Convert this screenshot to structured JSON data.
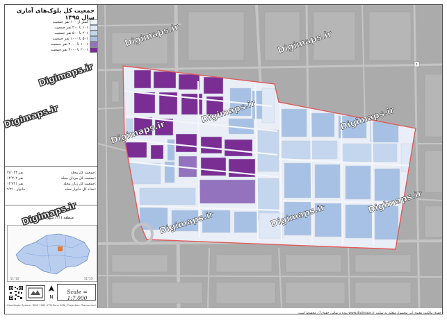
{
  "title": "جمعیت کل بلوک‌های آماری سال ۱۳۹۵",
  "legend": [
    {
      "label": "کمتر از ۱۰۰ نفر جمعیت",
      "color": "#edf2fa"
    },
    {
      "label": "۱۰۱ تا ۲۰۰ نفر جمعیت",
      "color": "#dfe8f6"
    },
    {
      "label": "۲۰۱ تا ۵۰۰ نفر جمعیت",
      "color": "#c4d6ee"
    },
    {
      "label": "۵۰۱ تا ۱۰۰۰ نفر جمعیت",
      "color": "#a7c1e4"
    },
    {
      "label": "۱۰۰۱ تا ۲۰۰۰ نفر جمعیت",
      "color": "#9373bd"
    },
    {
      "label": "۲۰۰۱ تا ۳۰۰۰ نفر جمعیت",
      "color": "#7a2e94"
    }
  ],
  "stats": [
    {
      "label": "جمعیت کل محله:",
      "value": "۲۸٬۰۲۳ نفر"
    },
    {
      "label": "جمعیت کل مردان محله:",
      "value": "۱۴٬۳۰۲ نفر"
    },
    {
      "label": "جمعیت کل زنان محله:",
      "value": "۱۳٬۷۲۱ نفر"
    },
    {
      "label": "تعداد کل خانوار محله:",
      "value": "۹٬۴۱۰ خانوار"
    }
  ],
  "location": {
    "line1": "محله امیریه",
    "line2": "منطقه (۱۱) شهرداری تهران"
  },
  "scale": "Scale = 1:7,000",
  "north": "N",
  "credit": "Coordinate System: WGS 1984 UTM Zone 39N | Projection: Transverse Mercator",
  "watermark": "Digimaps.ir",
  "disclaimer": "حقوق مالکیت معنوی این محصول متعلق به سایت www.digimaps.ir بوده و تمامی حقوق آن محفوظ است.",
  "colors": {
    "boundary": "#e05a5a",
    "street": "#bdbdbd",
    "map_bg": "#ababab",
    "inset_city": "#b9cdef",
    "inset_highlight": "#e07b39"
  },
  "icons": [
    "north-arrow-icon",
    "qr-code-icon",
    "digimaps-logo-icon",
    "parking-icon"
  ]
}
